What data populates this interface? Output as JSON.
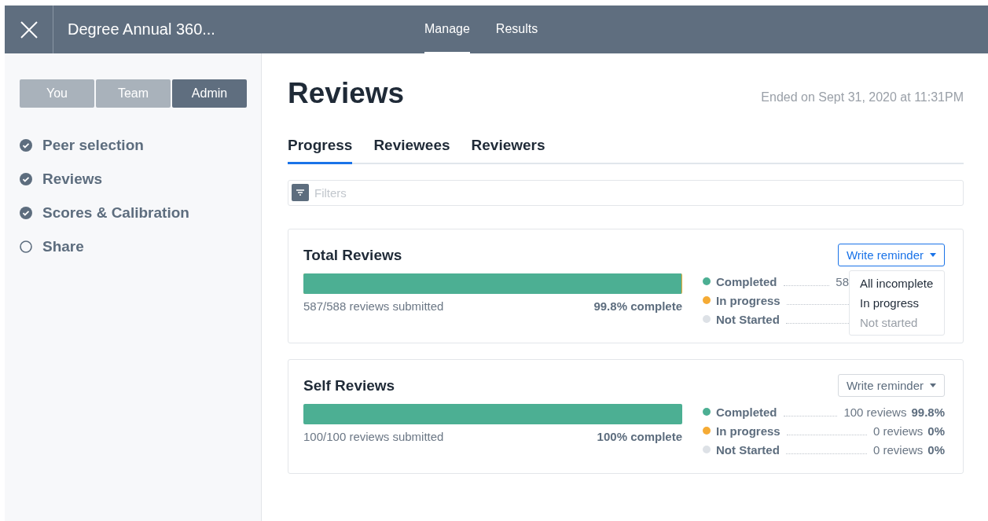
{
  "header": {
    "title": "Degree Annual 360...",
    "nav": [
      {
        "label": "Manage",
        "selected": true
      },
      {
        "label": "Results",
        "selected": false
      }
    ]
  },
  "sidebar": {
    "roles": [
      {
        "label": "You",
        "selected": false
      },
      {
        "label": "Team",
        "selected": false
      },
      {
        "label": "Admin",
        "selected": true
      }
    ],
    "steps": [
      {
        "label": "Peer selection",
        "checked": true
      },
      {
        "label": "Reviews",
        "checked": true
      },
      {
        "label": "Scores & Calibration",
        "checked": true
      },
      {
        "label": "Share",
        "checked": false
      }
    ]
  },
  "page": {
    "title": "Reviews",
    "ended": "Ended on Sept 31, 2020 at 11:31PM",
    "tabs": [
      {
        "label": "Progress",
        "selected": true
      },
      {
        "label": "Reviewees",
        "selected": false
      },
      {
        "label": "Reviewers",
        "selected": false
      }
    ],
    "filter": {
      "placeholder": "Filters"
    },
    "cards": [
      {
        "title": "Total Reviews",
        "level": 0.998,
        "submitted": "587/588 reviews submitted",
        "complete": "99.8% complete",
        "reminder": {
          "label": "Write reminder",
          "expanded": true,
          "options": [
            "All incomplete",
            "In progress",
            "Not started"
          ]
        },
        "stats": [
          {
            "label": "Completed",
            "color": "#4caf93",
            "count": "58"
          },
          {
            "label": "In progress",
            "color": "#f5ab35"
          },
          {
            "label": "Not Started",
            "color": "#dde1e6"
          }
        ]
      },
      {
        "title": "Self Reviews",
        "level": 1,
        "submitted": "100/100 reviews submitted",
        "complete": "100% complete",
        "reminder": {
          "label": "Write reminder",
          "expanded": false
        },
        "stats": [
          {
            "label": "Completed",
            "color": "#4caf93",
            "count": "100 reviews",
            "pct": "99.8%"
          },
          {
            "label": "In progress",
            "color": "#f5ab35",
            "count": "0 reviews",
            "pct": "0%"
          },
          {
            "label": "Not Started",
            "color": "#dde1e6",
            "count": "0 reviews",
            "pct": "0%"
          }
        ]
      }
    ]
  }
}
